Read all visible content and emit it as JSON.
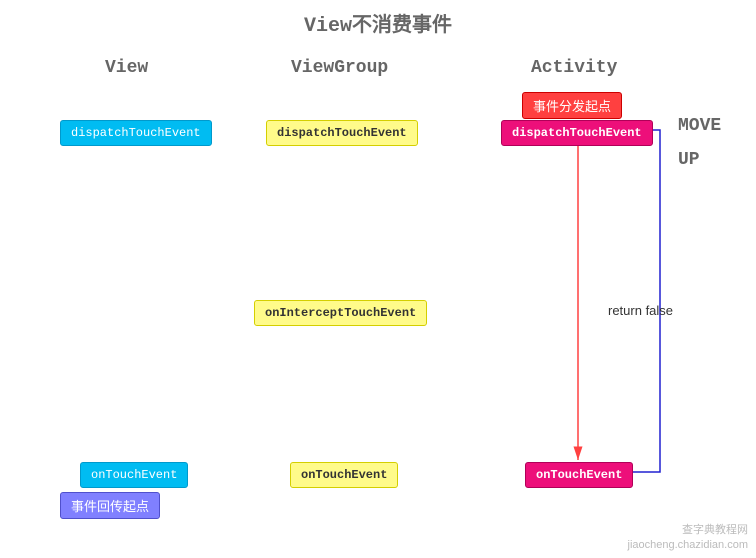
{
  "title": "View不消费事件",
  "columns": {
    "view": "View",
    "viewGroup": "ViewGroup",
    "activity": "Activity"
  },
  "tags": {
    "dispatchStart": "事件分发起点",
    "returnStart": "事件回传起点"
  },
  "nodes": {
    "viewDispatch": "dispatchTouchEvent",
    "vgDispatch": "dispatchTouchEvent",
    "actDispatch": "dispatchTouchEvent",
    "vgIntercept": "onInterceptTouchEvent",
    "viewTouch": "onTouchEvent",
    "vgTouch": "onTouchEvent",
    "actTouch": "onTouchEvent"
  },
  "side": {
    "move": "MOVE",
    "up": "UP"
  },
  "labels": {
    "returnFalse": "return false"
  },
  "watermark": {
    "l1": "查字典教程网",
    "l2": "jiaocheng.chazidian.com"
  }
}
